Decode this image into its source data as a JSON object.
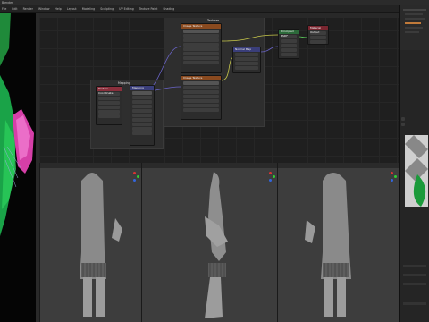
{
  "window": {
    "title": "Blender"
  },
  "menubar": {
    "items": [
      "File",
      "Edit",
      "Render",
      "Window",
      "Help",
      "Layout",
      "Modeling",
      "Sculpting",
      "UV Editing",
      "Texture Paint",
      "Shading"
    ]
  },
  "node_editor": {
    "frames": {
      "mapping": "Mapping",
      "textures": "Textures"
    },
    "nodes": {
      "tex_coord": "Texture Coordinate",
      "mapping": "Mapping",
      "image_tex_1": "Image Texture",
      "image_tex_2": "Image Texture",
      "normal_map": "Normal Map",
      "bsdf": "Principled BSDF",
      "output": "Material Output"
    }
  },
  "colors": {
    "accent_node_red": "#8a2f3c",
    "accent_node_blue": "#3a3e7a",
    "image_node": "#8a4a1f",
    "bsdf_green": "#2c6a3a",
    "output_red": "#7a2630",
    "link_yellow": "#c8c84a",
    "link_purple": "#6a64c8",
    "link_green": "#5ac85a"
  },
  "viewports": {
    "count": 3
  }
}
